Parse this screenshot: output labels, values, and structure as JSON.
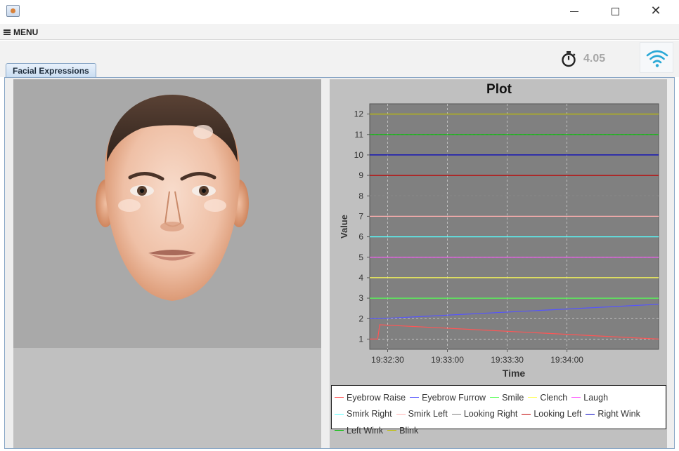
{
  "window": {
    "minimize_glyph": "",
    "close_glyph": "✕"
  },
  "menu": {
    "label": "MENU",
    "icon": "hamburger-icon"
  },
  "status": {
    "timer_value": "4.05",
    "timer_icon": "stopwatch-icon",
    "wifi_icon": "wifi-icon",
    "wifi_color": "#29a8d6"
  },
  "tabs": [
    {
      "label": "Facial Expressions",
      "selected": true
    }
  ],
  "face_panel": {
    "image": "rendered-3d-face"
  },
  "chart_data": {
    "type": "line",
    "title": "Plot",
    "xlabel": "Time",
    "ylabel": "Value",
    "ylim": [
      0.5,
      12.5
    ],
    "yticks": [
      1,
      2,
      3,
      4,
      5,
      6,
      7,
      8,
      9,
      10,
      11,
      12
    ],
    "xlim": [
      "19:32:21",
      "19:34:46"
    ],
    "xticks": [
      "19:32:30",
      "19:33:00",
      "19:33:30",
      "19:34:00"
    ],
    "grid": true,
    "background": "#808080",
    "legend_position": "bottom",
    "series": [
      {
        "name": "Eyebrow Raise",
        "color": "#ff5555",
        "points": [
          [
            "19:32:21",
            1.0
          ],
          [
            "19:32:25",
            1.0
          ],
          [
            "19:32:26",
            1.7
          ],
          [
            "19:34:46",
            1.0
          ]
        ]
      },
      {
        "name": "Eyebrow Furrow",
        "color": "#5555ff",
        "points": [
          [
            "19:32:21",
            2.0
          ],
          [
            "19:32:26",
            2.0
          ],
          [
            "19:34:46",
            2.7
          ]
        ]
      },
      {
        "name": "Smile",
        "color": "#55ff55",
        "points": [
          [
            "19:32:21",
            3.0
          ],
          [
            "19:34:46",
            3.0
          ]
        ]
      },
      {
        "name": "Clench",
        "color": "#ffff55",
        "points": [
          [
            "19:32:21",
            4.0
          ],
          [
            "19:34:46",
            4.0
          ]
        ]
      },
      {
        "name": "Laugh",
        "color": "#ff55ff",
        "points": [
          [
            "19:32:21",
            5.0
          ],
          [
            "19:34:46",
            5.0
          ]
        ]
      },
      {
        "name": "Smirk Right",
        "color": "#55ffff",
        "points": [
          [
            "19:32:21",
            6.0
          ],
          [
            "19:34:46",
            6.0
          ]
        ]
      },
      {
        "name": "Smirk Left",
        "color": "#ffafaf",
        "points": [
          [
            "19:32:21",
            7.0
          ],
          [
            "19:34:46",
            7.0
          ]
        ]
      },
      {
        "name": "Looking Right",
        "color": "#808080",
        "points": [
          [
            "19:32:21",
            8.0
          ],
          [
            "19:34:46",
            8.0
          ]
        ]
      },
      {
        "name": "Looking Left",
        "color": "#c00000",
        "points": [
          [
            "19:32:21",
            9.0
          ],
          [
            "19:34:46",
            9.0
          ]
        ]
      },
      {
        "name": "Right Wink",
        "color": "#0000c0",
        "points": [
          [
            "19:32:21",
            10.0
          ],
          [
            "19:34:46",
            10.0
          ]
        ]
      },
      {
        "name": "Left Wink",
        "color": "#00c000",
        "points": [
          [
            "19:32:21",
            11.0
          ],
          [
            "19:34:46",
            11.0
          ]
        ]
      },
      {
        "name": "Blink",
        "color": "#c0c000",
        "points": [
          [
            "19:32:21",
            12.0
          ],
          [
            "19:34:46",
            12.0
          ]
        ]
      }
    ]
  }
}
